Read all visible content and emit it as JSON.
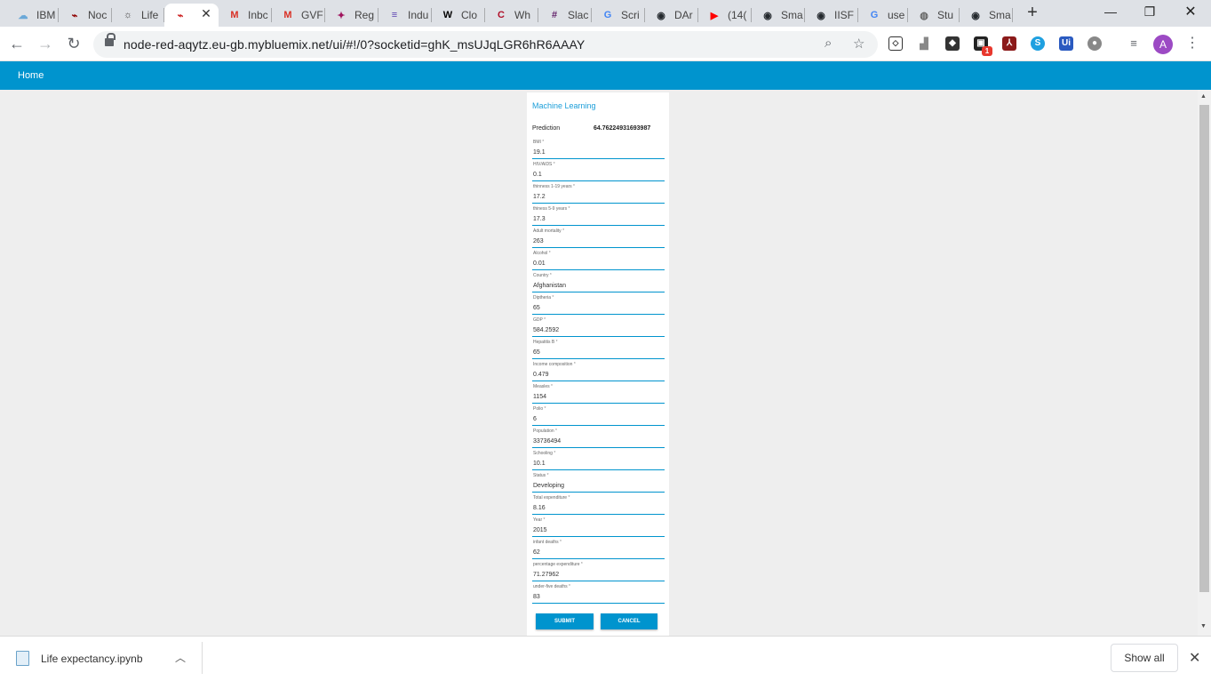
{
  "browser": {
    "tabs": [
      {
        "label": "IBM",
        "icon": "cloud-icon",
        "color": "#6aa8d8",
        "glyph": "☁"
      },
      {
        "label": "Noc",
        "icon": "node-red-icon",
        "color": "#8f0000",
        "glyph": "⌁"
      },
      {
        "label": "Life",
        "icon": "bulb-icon",
        "color": "#444444",
        "glyph": "☼"
      },
      {
        "label": "",
        "icon": "node-red-icon",
        "color": "#cc2020",
        "glyph": "⌁",
        "active": true
      },
      {
        "label": "Inbc",
        "icon": "gmail-icon",
        "color": "#d93025",
        "glyph": "M"
      },
      {
        "label": "GVF",
        "icon": "gmail-icon",
        "color": "#d93025",
        "glyph": "M"
      },
      {
        "label": "Reg",
        "icon": "app-icon",
        "color": "#a0155e",
        "glyph": "✦"
      },
      {
        "label": "Indu",
        "icon": "list-icon",
        "color": "#5a3fb0",
        "glyph": "≡"
      },
      {
        "label": "Clo",
        "icon": "wikipedia-icon",
        "color": "#000000",
        "glyph": "W"
      },
      {
        "label": "Wh",
        "icon": "c-icon",
        "color": "#b0102a",
        "glyph": "C"
      },
      {
        "label": "Slac",
        "icon": "slack-icon",
        "color": "#611f69",
        "glyph": "#"
      },
      {
        "label": "Scri",
        "icon": "google-icon",
        "color": "#4285f4",
        "glyph": "G"
      },
      {
        "label": "DAr",
        "icon": "github-icon",
        "color": "#24292e",
        "glyph": "◉"
      },
      {
        "label": "(14(",
        "icon": "youtube-icon",
        "color": "#ff0000",
        "glyph": "▶"
      },
      {
        "label": "Sma",
        "icon": "github-icon",
        "color": "#24292e",
        "glyph": "◉"
      },
      {
        "label": "IISF",
        "icon": "github-icon",
        "color": "#24292e",
        "glyph": "◉"
      },
      {
        "label": "use",
        "icon": "google-icon",
        "color": "#4285f4",
        "glyph": "G"
      },
      {
        "label": "Stu",
        "icon": "globe-icon",
        "color": "#666666",
        "glyph": "◍"
      },
      {
        "label": "Sma",
        "icon": "github-icon",
        "color": "#24292e",
        "glyph": "◉"
      }
    ],
    "url": "node-red-aqytz.eu-gb.mybluemix.net/ui/#!/0?socketid=ghK_msUJqLGR6hR6AAAY",
    "ext_badge": "1",
    "avatar_letter": "A"
  },
  "dashboard": {
    "header_title": "Home",
    "group_title": "Machine Learning",
    "prediction_label": "Prediction",
    "prediction_value": "64.76224931693987",
    "fields": [
      {
        "label": "BMI",
        "value": "19.1"
      },
      {
        "label": "HIV/AIDS",
        "value": "0.1"
      },
      {
        "label": "thinness 1-19 years",
        "value": "17.2"
      },
      {
        "label": "thiness 5-9 years",
        "value": "17.3"
      },
      {
        "label": "Adult mortality",
        "value": "263"
      },
      {
        "label": "Alcohol",
        "value": "0.01"
      },
      {
        "label": "Country",
        "value": "Afghanistan"
      },
      {
        "label": "Diptheria",
        "value": "65"
      },
      {
        "label": "GDP",
        "value": "584.2592"
      },
      {
        "label": "Hepatitis B",
        "value": "65"
      },
      {
        "label": "Income composition",
        "value": "0.479"
      },
      {
        "label": "Measles",
        "value": "1154"
      },
      {
        "label": "Polio",
        "value": "6"
      },
      {
        "label": "Population",
        "value": "33736494"
      },
      {
        "label": "Schooling",
        "value": "10.1"
      },
      {
        "label": "Status",
        "value": "Developing"
      },
      {
        "label": "Total expenditure",
        "value": "8.16"
      },
      {
        "label": "Year",
        "value": "2015"
      },
      {
        "label": "infant deaths",
        "value": "62"
      },
      {
        "label": "percentage expenditure",
        "value": "71.27962"
      },
      {
        "label": "under-five deaths",
        "value": "83"
      }
    ],
    "submit_label": "SUBMIT",
    "cancel_label": "CANCEL",
    "accent_color": "#0094ce"
  },
  "downloads": {
    "file_name": "Life expectancy.ipynb",
    "show_all_label": "Show all"
  }
}
